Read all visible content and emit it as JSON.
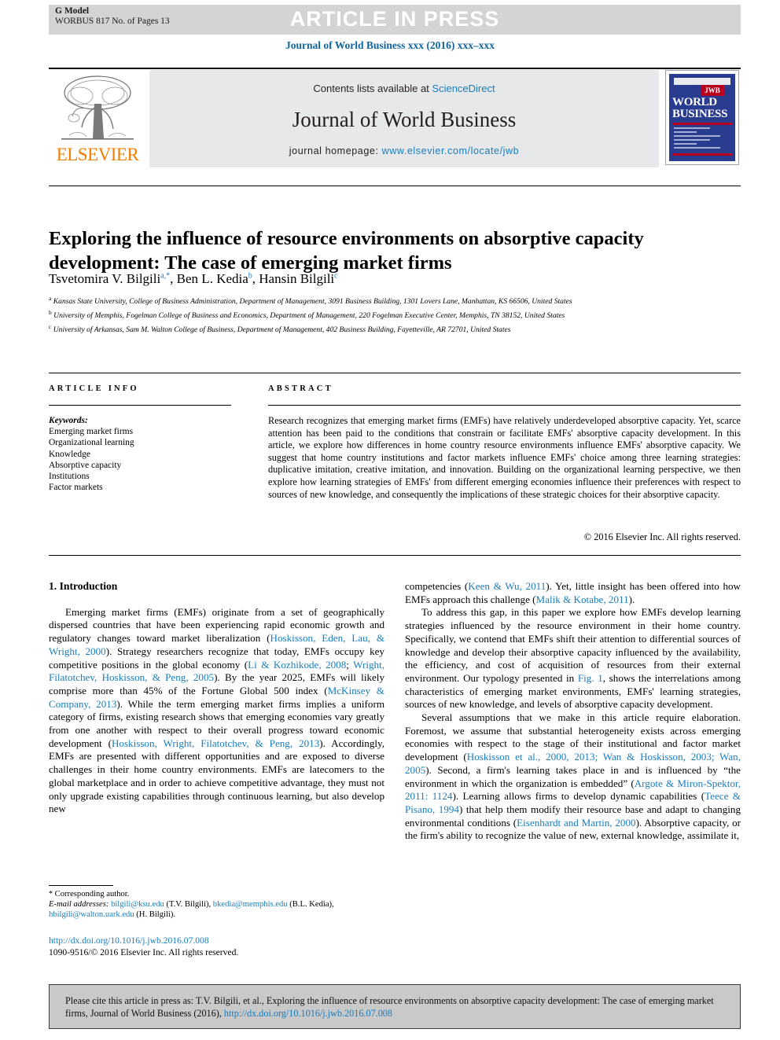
{
  "running_head": {
    "g_model": "G Model",
    "article_id": "WORBUS 817 No. of Pages 13",
    "press_banner": "ARTICLE IN PRESS",
    "journal_line": "Journal of World Business xxx (2016) xxx–xxx"
  },
  "masthead": {
    "contents_prefix": "Contents lists available at ",
    "sciencedirect": "ScienceDirect",
    "journal_title": "Journal of World Business",
    "homepage_prefix": "journal homepage: ",
    "homepage_url": "www.elsevier.com/locate/jwb",
    "publisher_logo_text": "ELSEVIER",
    "cover": {
      "badge": "JWB",
      "line1": "WORLD",
      "line2": "BUSINESS"
    }
  },
  "article": {
    "title": "Exploring the influence of resource environments on absorptive capacity development: The case of emerging market firms",
    "authors_html": "Tsvetomira V. Bilgili<sup>a,*</sup>, Ben L. Kedia<sup>b</sup>, Hansin Bilgili<sup>c</sup>",
    "affiliations": [
      "Kansas State University, College of Business Administration, Department of Management, 3091 Business Building, 1301 Lovers Lane, Manhattan, KS 66506, United States",
      "University of Memphis, Fogelman College of Business and Economics, Department of Management, 220 Fogelman Executive Center, Memphis, TN 38152, United States",
      "University of Arkansas, Sam M. Walton College of Business, Department of Management, 402 Business Building, Fayetteville, AR 72701, United States"
    ],
    "affiliation_markers": [
      "a",
      "b",
      "c"
    ]
  },
  "info": {
    "article_info_heading": "ARTICLE INFO",
    "abstract_heading": "ABSTRACT",
    "keywords_label": "Keywords:",
    "keywords": [
      "Emerging market firms",
      "Organizational learning",
      "Knowledge",
      "Absorptive capacity",
      "Institutions",
      "Factor markets"
    ],
    "abstract": "Research recognizes that emerging market firms (EMFs) have relatively underdeveloped absorptive capacity. Yet, scarce attention has been paid to the conditions that constrain or facilitate EMFs' absorptive capacity development. In this article, we explore how differences in home country resource environments influence EMFs' absorptive capacity. We suggest that home country institutions and factor markets influence EMFs' choice among three learning strategies: duplicative imitation, creative imitation, and innovation. Building on the organizational learning perspective, we then explore how learning strategies of EMFs' from different emerging economies influence their preferences with respect to sources of new knowledge, and consequently the implications of these strategic choices for their absorptive capacity.",
    "copyright": "© 2016 Elsevier Inc. All rights reserved."
  },
  "body": {
    "section_heading": "1. Introduction",
    "left_paragraph_1_parts": [
      "Emerging market firms (EMFs) originate from a set of geographically dispersed countries that have been experiencing rapid economic growth and regulatory changes toward market liberalization (",
      "Hoskisson, Eden, Lau, & Wright, 2000",
      "). Strategy researchers recognize that today, EMFs occupy key competitive positions in the global economy (",
      "Li & Kozhikode, 2008",
      "; ",
      "Wright, Filatotchev, Hoskisson, & Peng, 2005",
      "). By the year 2025, EMFs will likely comprise more than 45% of the Fortune Global 500 index (",
      "McKinsey & Company, 2013",
      "). While the term emerging market firms implies a uniform category of firms, existing research shows that emerging economies vary greatly from one another with respect to their overall progress toward economic development (",
      "Hoskisson, Wright, Filatotchev, & Peng, 2013",
      "). Accordingly, EMFs are presented with different opportunities and are exposed to diverse challenges in their home country environments. EMFs are latecomers to the global marketplace and in order to achieve competitive advantage, they must not only upgrade existing capabilities through continuous learning, but also develop new"
    ],
    "right_paragraph_1_parts": [
      "competencies (",
      "Keen & Wu, 2011",
      "). Yet, little insight has been offered into how EMFs approach this challenge (",
      "Malik & Kotabe, 2011",
      ")."
    ],
    "right_paragraph_2_parts": [
      "To address this gap, in this paper we explore how EMFs develop learning strategies influenced by the resource environment in their home country. Specifically, we contend that EMFs shift their attention to differential sources of knowledge and develop their absorptive capacity influenced by the availability, the efficiency, and cost of acquisition of resources from their external environment. Our typology presented in ",
      "Fig. 1",
      ", shows the interrelations among characteristics of emerging market environments, EMFs' learning strategies, sources of new knowledge, and levels of absorptive capacity development."
    ],
    "right_paragraph_3_parts": [
      "Several assumptions that we make in this article require elaboration. Foremost, we assume that substantial heterogeneity exists across emerging economies with respect to the stage of their institutional and factor market development (",
      "Hoskisson et al., 2000, 2013; Wan & Hoskisson, 2003; Wan, 2005",
      "). Second, a firm's learning takes place in and is influenced by “the environment in which the organization is embedded” (",
      "Argote & Miron-Spektor, 2011: 1124",
      "). Learning allows firms to develop dynamic capabilities (",
      "Teece & Pisano, 1994",
      ") that help them modify their resource base and adapt to changing environmental conditions (",
      "Eisenhardt and Martin, 2000",
      "). Absorptive capacity, or the firm's ability to recognize the value of new, external knowledge, assimilate it,"
    ]
  },
  "footnote": {
    "corresponding_marker": "*",
    "corresponding_label": "Corresponding author.",
    "email_label": "E-mail addresses:",
    "emails": [
      {
        "address": "bilgili@ksu.edu",
        "owner": "(T.V. Bilgili)"
      },
      {
        "address": "bkedia@memphis.edu",
        "owner": "(B.L. Kedia)"
      },
      {
        "address": "hbilgili@walton.uark.edu",
        "owner": "(H. Bilgili)"
      }
    ],
    "doi": "http://dx.doi.org/10.1016/j.jwb.2016.07.008",
    "issn_line": "1090-9516/© 2016 Elsevier Inc. All rights reserved."
  },
  "cite_box": {
    "text_prefix": "Please cite this article in press as: T.V. Bilgili, et al., Exploring the influence of resource environments on absorptive capacity development: The case of emerging market firms, Journal of World Business (2016), ",
    "doi": "http://dx.doi.org/10.1016/j.jwb.2016.07.008"
  },
  "colors": {
    "link_blue": "#1a7dbd",
    "journal_blue": "#12659c",
    "elsevier_orange": "#ef7d00",
    "cover_blue": "#2a3c8f",
    "cover_red": "#b9001f",
    "band_gray": "#d4d4d4",
    "panel_gray": "#e7e8ea",
    "cite_gray": "#c9c9c9"
  }
}
